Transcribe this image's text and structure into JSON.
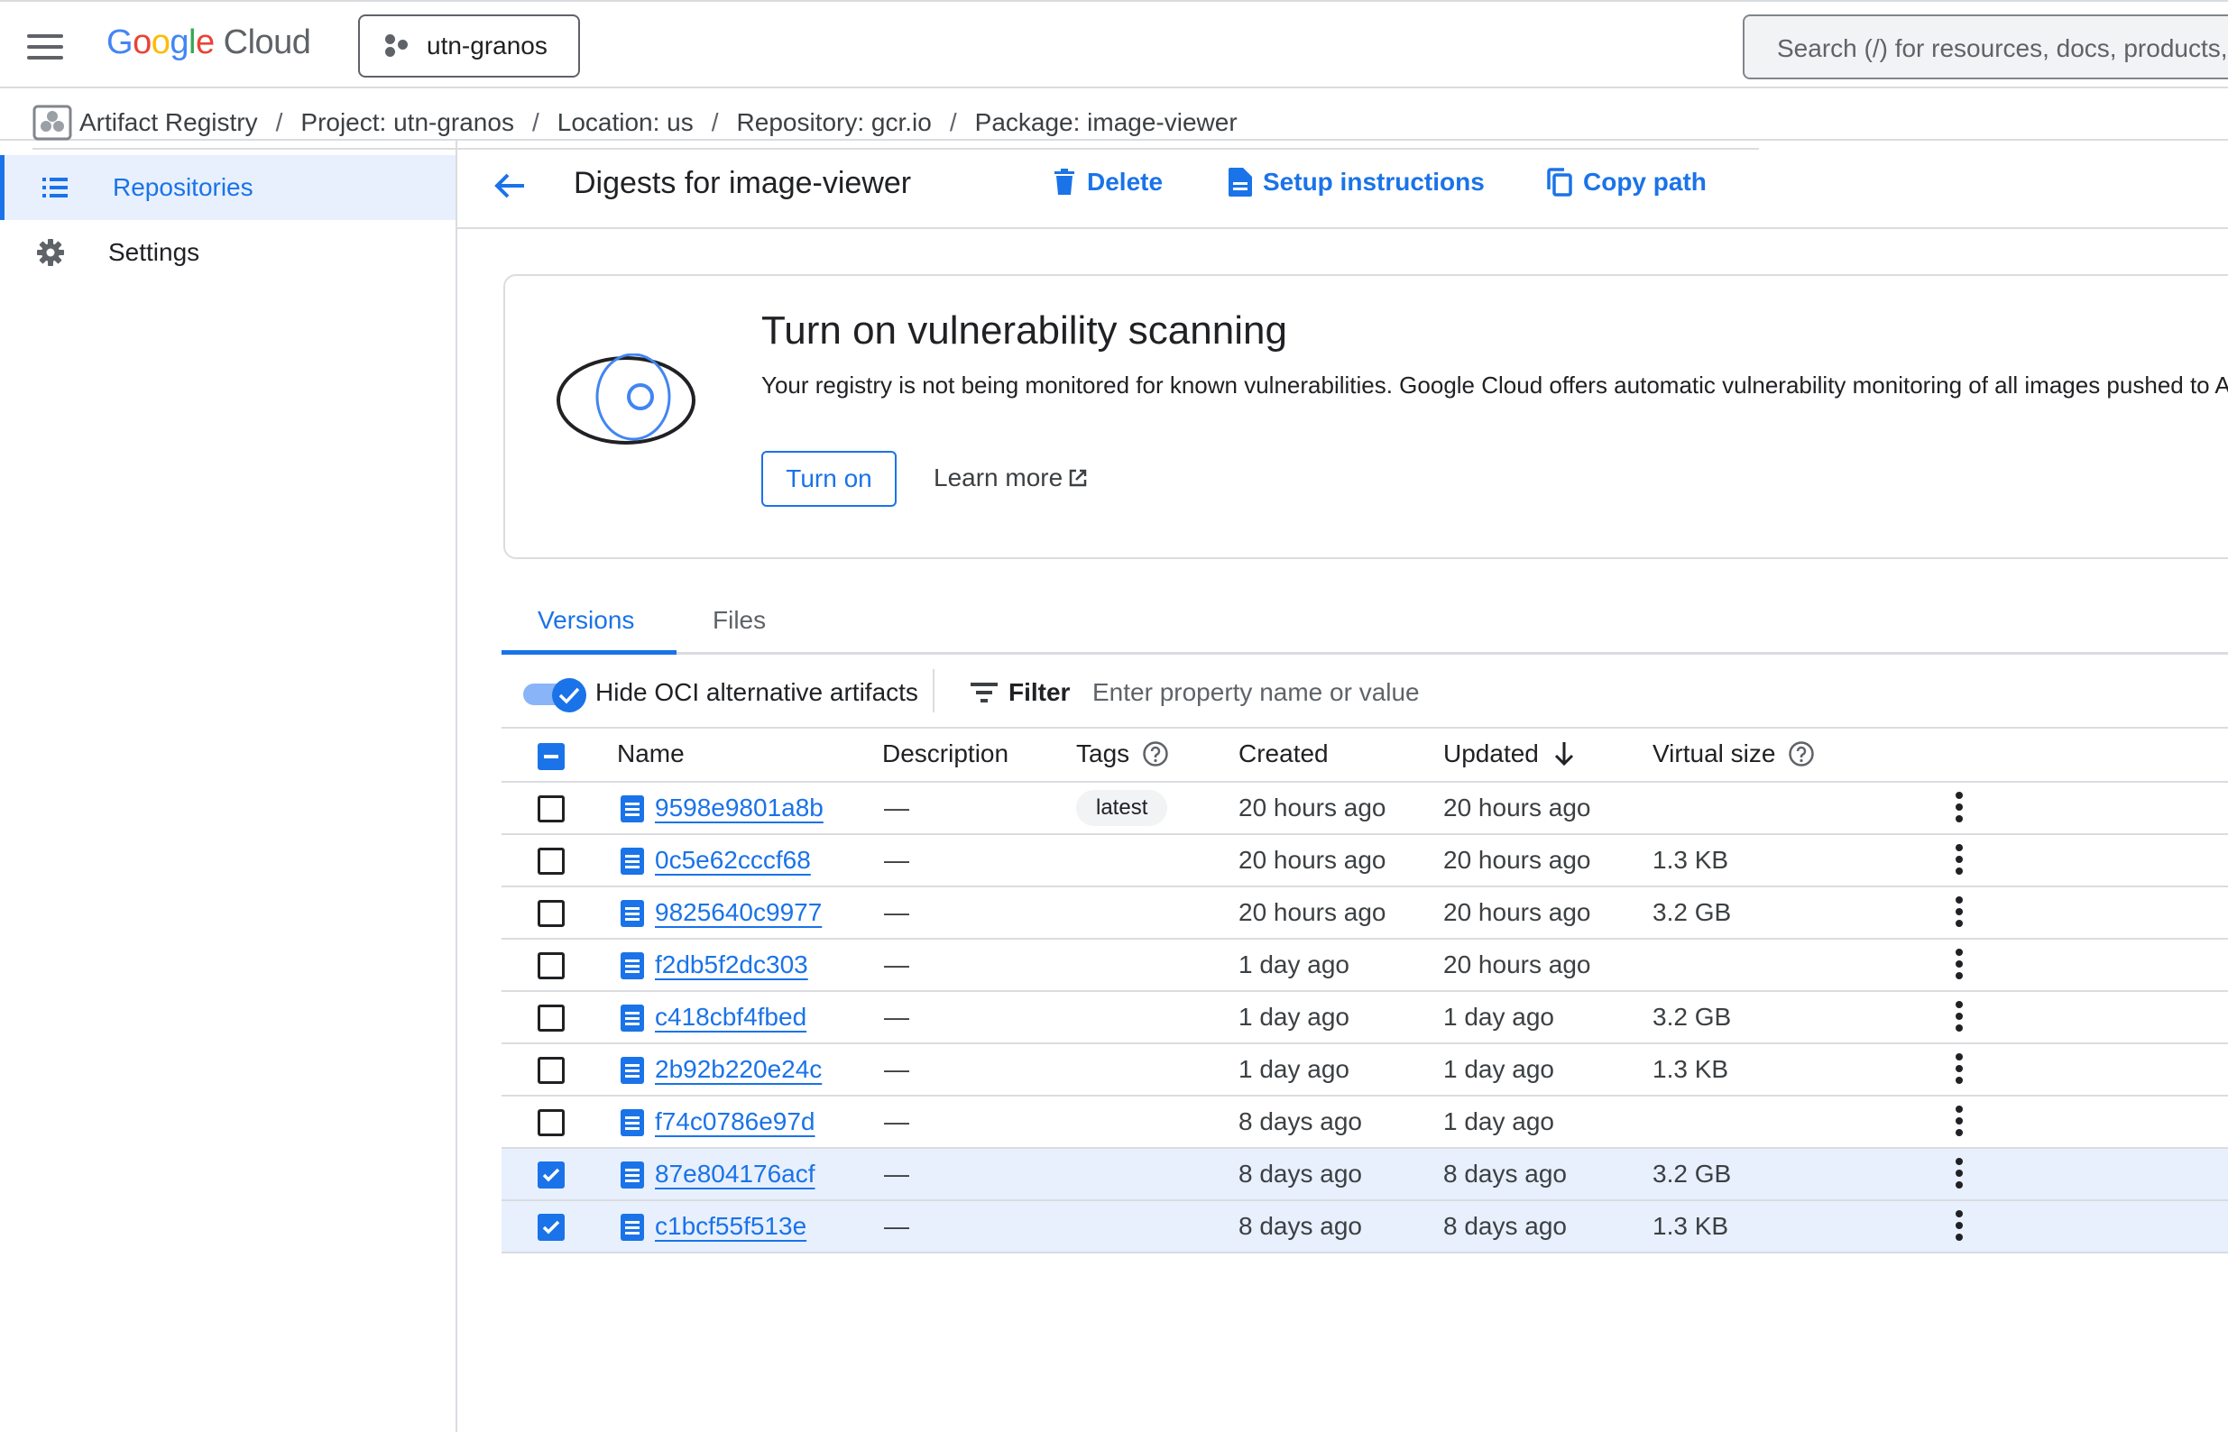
{
  "topbar": {
    "logo_google": "Google",
    "logo_cloud": "Cloud",
    "project": "utn-granos",
    "search_placeholder": "Search (/) for resources, docs, products, and more"
  },
  "breadcrumb": [
    "Artifact Registry",
    "Project: utn-granos",
    "Location: us",
    "Repository: gcr.io",
    "Package: image-viewer"
  ],
  "sidebar": {
    "items": [
      {
        "label": "Repositories",
        "icon": "list-icon",
        "active": true
      },
      {
        "label": "Settings",
        "icon": "gear-icon",
        "active": false
      }
    ]
  },
  "header": {
    "title": "Digests for image-viewer",
    "delete": "Delete",
    "setup": "Setup instructions",
    "copy_path": "Copy path"
  },
  "banner": {
    "title": "Turn on vulnerability scanning",
    "text": "Your registry is not being monitored for known vulnerabilities. Google Cloud offers automatic vulnerability monitoring of all images pushed to Artifact Registry.",
    "turn_on": "Turn on",
    "learn_more": "Learn more"
  },
  "tabs": [
    "Versions",
    "Files"
  ],
  "toolbar": {
    "toggle_label": "Hide OCI alternative artifacts",
    "toggle_on": true,
    "filter_label": "Filter",
    "filter_placeholder": "Enter property name or value"
  },
  "table": {
    "columns": [
      "Name",
      "Description",
      "Tags",
      "Created",
      "Updated",
      "Virtual size"
    ],
    "rows": [
      {
        "name": "9598e9801a8b",
        "desc": "—",
        "tag": "latest",
        "created": "20 hours ago",
        "updated": "20 hours ago",
        "size": "",
        "selected": false
      },
      {
        "name": "0c5e62cccf68",
        "desc": "—",
        "tag": "",
        "created": "20 hours ago",
        "updated": "20 hours ago",
        "size": "1.3 KB",
        "selected": false
      },
      {
        "name": "9825640c9977",
        "desc": "—",
        "tag": "",
        "created": "20 hours ago",
        "updated": "20 hours ago",
        "size": "3.2 GB",
        "selected": false
      },
      {
        "name": "f2db5f2dc303",
        "desc": "—",
        "tag": "",
        "created": "1 day ago",
        "updated": "20 hours ago",
        "size": "",
        "selected": false
      },
      {
        "name": "c418cbf4fbed",
        "desc": "—",
        "tag": "",
        "created": "1 day ago",
        "updated": "1 day ago",
        "size": "3.2 GB",
        "selected": false
      },
      {
        "name": "2b92b220e24c",
        "desc": "—",
        "tag": "",
        "created": "1 day ago",
        "updated": "1 day ago",
        "size": "1.3 KB",
        "selected": false
      },
      {
        "name": "f74c0786e97d",
        "desc": "—",
        "tag": "",
        "created": "8 days ago",
        "updated": "1 day ago",
        "size": "",
        "selected": false
      },
      {
        "name": "87e804176acf",
        "desc": "—",
        "tag": "",
        "created": "8 days ago",
        "updated": "8 days ago",
        "size": "3.2 GB",
        "selected": true
      },
      {
        "name": "c1bcf55f513e",
        "desc": "—",
        "tag": "",
        "created": "8 days ago",
        "updated": "8 days ago",
        "size": "1.3 KB",
        "selected": true
      }
    ]
  },
  "colors": {
    "accent": "#1a73e8",
    "selected_row": "#e8f0fe"
  }
}
